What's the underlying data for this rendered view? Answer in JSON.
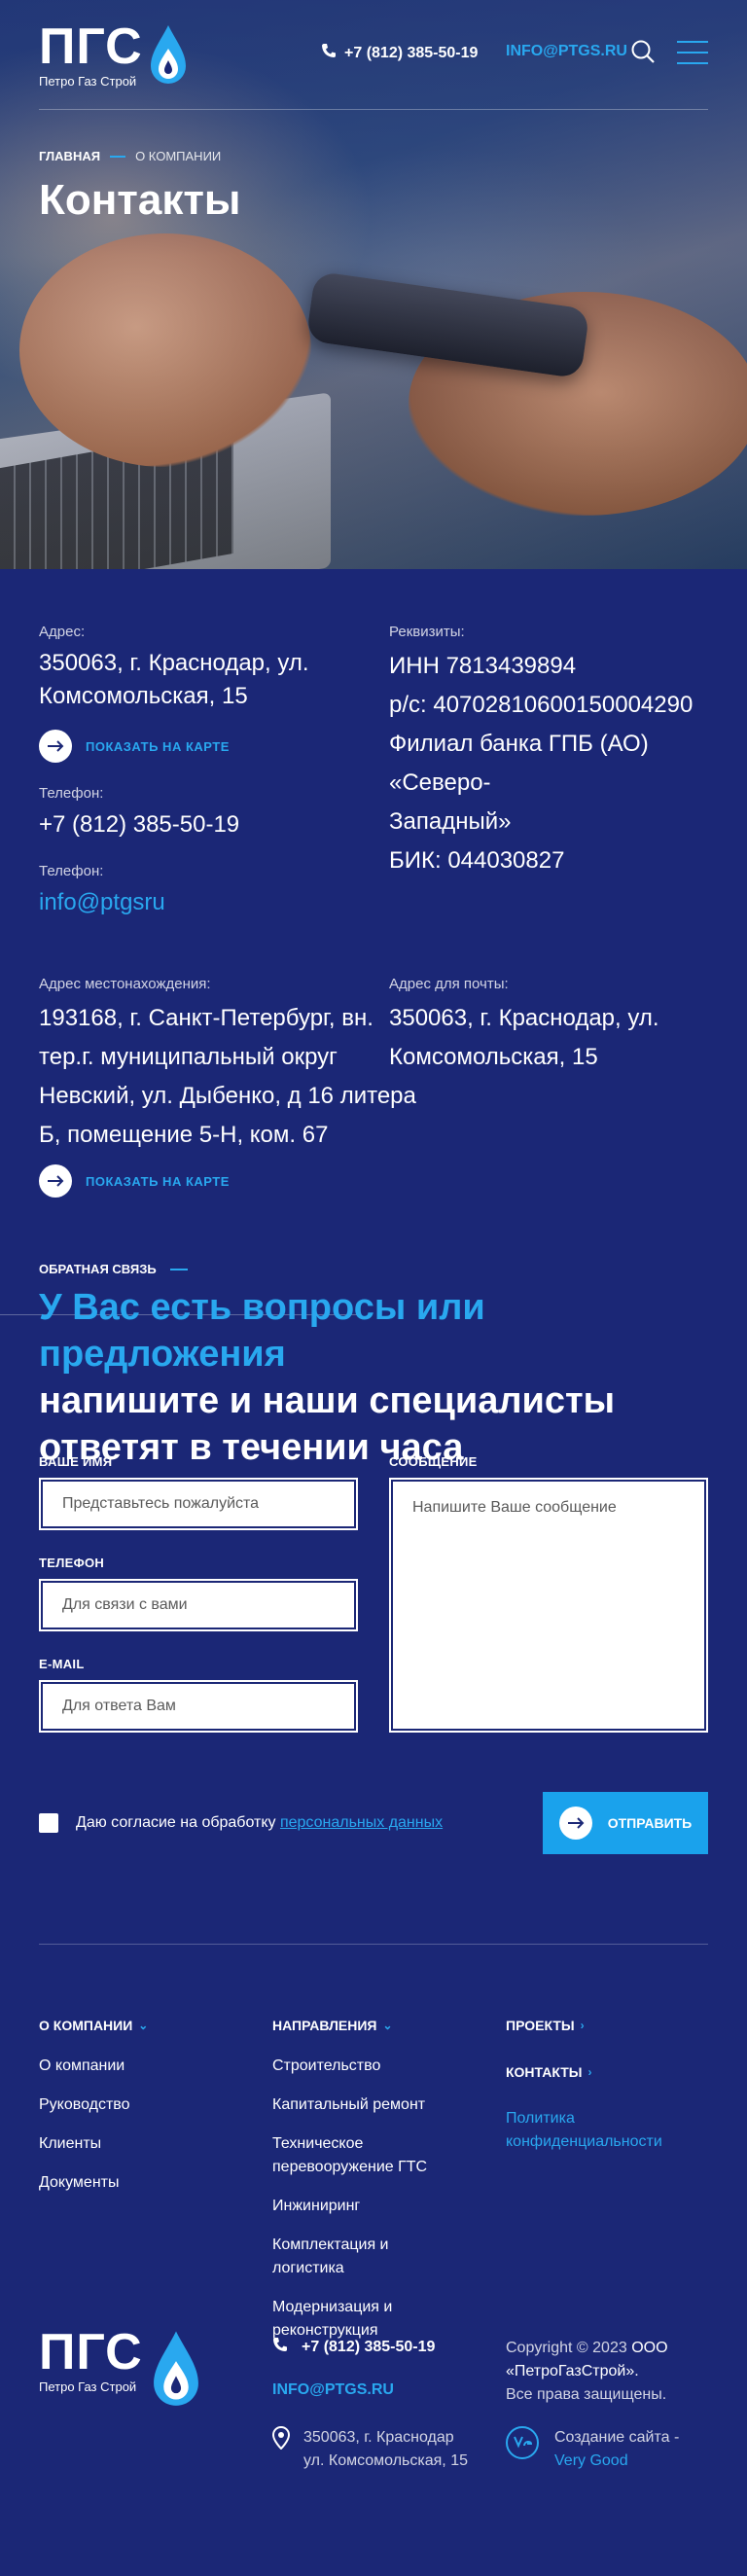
{
  "header": {
    "logo_big": "ПГС",
    "logo_small": "Петро Газ Строй",
    "phone": "+7 (812) 385-50-19",
    "email": "INFO@PTGS.RU"
  },
  "breadcrumb": {
    "home": "ГЛАВНАЯ",
    "current": "О КОМПАНИИ"
  },
  "page_title": "Контакты",
  "contacts": {
    "address_label": "Адрес:",
    "address_line1": "350063, г. Краснодар, ул.",
    "address_line2": "Комсомольская, 15",
    "show_map": "ПОКАЗАТЬ НА КАРТЕ",
    "phone_label": "Телефон:",
    "phone": "+7 (812) 385-50-19",
    "email_label": "Телефон:",
    "email": "info@ptgsru",
    "requisites_label": "Реквизиты:",
    "req_inn": "ИНН 7813439894",
    "req_account": "р/с: 40702810600150004290",
    "req_bank_line1": "Филиал банка ГПБ (АО)  «Северо-",
    "req_bank_line2": "Западный»",
    "req_bik": "БИК: 044030827",
    "location_label": "Адрес местонахождения:",
    "location_line1": "193168, г. Санкт-Петербург, вн.",
    "location_line2": "тер.г. муниципальный округ",
    "location_line3": "Невский, ул. Дыбенко, д 16 литера",
    "location_line4": "Б, помещение 5-Н, ком. 67",
    "show_map_2": "ПОКАЗАТЬ НА КАРТЕ",
    "post_label": "Адрес для почты:",
    "post_line1": "350063, г. Краснодар, ул.",
    "post_line2": "Комсомольская, 15",
    "feedback_tag": "ОБРАТНАЯ СВЯЗЬ"
  },
  "form": {
    "title_accent": "У Вас есть вопросы или предложения",
    "title_rest": "напишите и наши специалисты ответят в течении часа",
    "name_label": "ВАШЕ ИМЯ",
    "name_placeholder": "Представьтесь пожалуйста",
    "phone_label": "ТЕЛЕФОН",
    "phone_placeholder": "Для связи с вами",
    "email_label": "E-MAIL",
    "email_placeholder": "Для ответа Вам",
    "message_label": "СООБЩЕНИЕ",
    "message_placeholder": "Напишите Ваше сообщение",
    "consent_text": "Даю согласие на обработку",
    "consent_link": "персональных данных",
    "send_label": "ОТПРАВИТЬ"
  },
  "footer": {
    "col1_head": "О КОМПАНИИ",
    "col1_items": [
      "О компании",
      "Руководство",
      "Клиенты",
      "Документы"
    ],
    "col2_head": "НАПРАВЛЕНИЯ",
    "col2_items": [
      "Строительство",
      "Капитальный ремонт",
      "Техническое перевооружение ГТС",
      "Инжиниринг",
      "Комплектация и логистика",
      "Модернизация и реконструкция"
    ],
    "col3_head1": "ПРОЕКТЫ",
    "col3_head2": "КОНТАКТЫ",
    "policy": "Политика конфиденциальности",
    "logo_big": "ПГС",
    "logo_small": "Петро Газ Строй",
    "phone": "+7 (812) 385-50-19",
    "email": "INFO@PTGS.RU",
    "address_line1": "350063, г. Краснодар",
    "address_line2": "ул. Комсомольская, 15",
    "copyright_pre": "Copyright © 2023",
    "copyright_org": "ООО «ПетроГазСтрой».",
    "copyright_rights": "Все права защищены.",
    "dev_label": "Создание сайта -",
    "dev_name": "Very Good"
  },
  "colors": {
    "background": "#1b2776",
    "accent": "#29a8ef",
    "button": "#1aa2ec"
  }
}
